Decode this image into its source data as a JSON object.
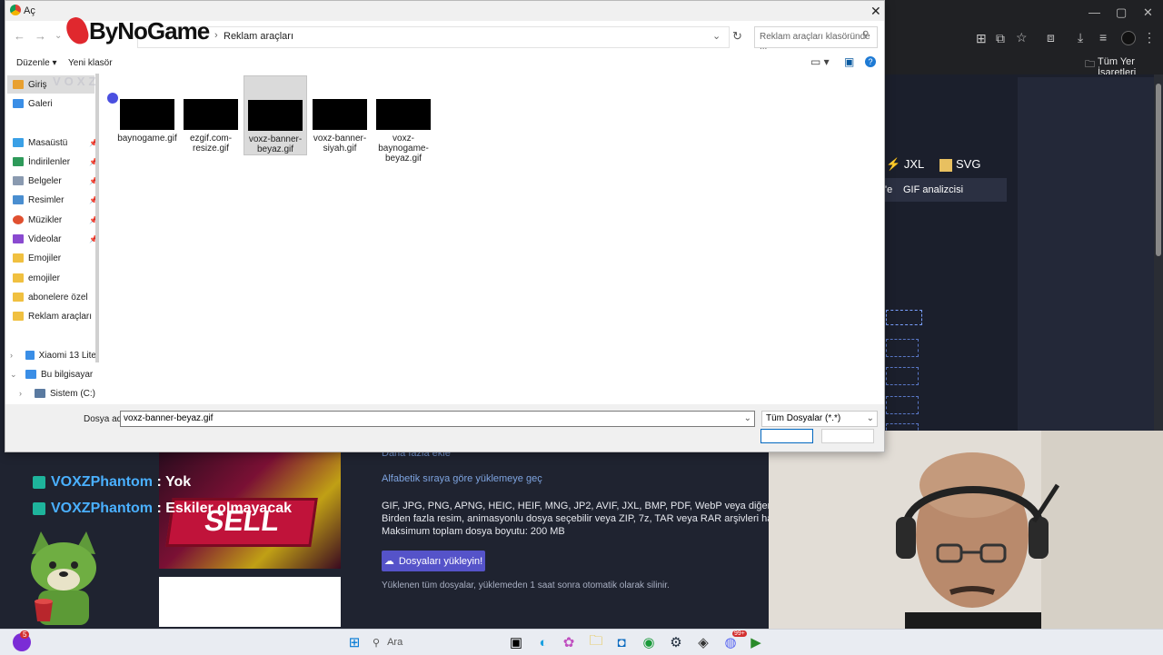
{
  "dialog": {
    "title": "Aç",
    "breadcrumb": [
      "Reklam araçları"
    ],
    "search_placeholder": "Reklam araçları klasöründe ...",
    "toolbar": {
      "organize": "Düzenle",
      "new_folder": "Yeni klasör"
    },
    "sidebar": {
      "items": [
        {
          "label": "Giriş",
          "icon": "home-icon",
          "pinned": false
        },
        {
          "label": "Galeri",
          "icon": "gallery-icon",
          "pinned": false
        },
        {
          "label": "Masaüstü",
          "icon": "desktop-icon",
          "pinned": true
        },
        {
          "label": "İndirilenler",
          "icon": "download-icon",
          "pinned": true
        },
        {
          "label": "Belgeler",
          "icon": "documents-icon",
          "pinned": true
        },
        {
          "label": "Resimler",
          "icon": "pictures-icon",
          "pinned": true
        },
        {
          "label": "Müzikler",
          "icon": "music-icon",
          "pinned": true
        },
        {
          "label": "Videolar",
          "icon": "videos-icon",
          "pinned": true
        },
        {
          "label": "Emojiler",
          "icon": "folder-icon",
          "pinned": false
        },
        {
          "label": "emojiler",
          "icon": "folder-icon",
          "pinned": false
        },
        {
          "label": "abonelere özel",
          "icon": "folder-icon",
          "pinned": false
        },
        {
          "label": "Reklam araçları",
          "icon": "folder-icon",
          "pinned": false
        },
        {
          "label": "Xiaomi 13 Lite",
          "icon": "phone-icon",
          "pinned": false
        },
        {
          "label": "Bu bilgisayar",
          "icon": "computer-icon",
          "pinned": false
        },
        {
          "label": "Sistem (C:)",
          "icon": "drive-icon",
          "pinned": false
        }
      ]
    },
    "files": [
      {
        "name": "baynogame.gif",
        "selected": false
      },
      {
        "name": "ezgif.com-resize.gif",
        "selected": false
      },
      {
        "name": "voxz-banner-beyaz.gif",
        "selected": true
      },
      {
        "name": "voxz-banner-siyah.gif",
        "selected": false
      },
      {
        "name": "voxz-baynogame-beyaz.gif",
        "selected": false
      }
    ],
    "filename_label": "Dosya adı:",
    "filename_value": "voxz-banner-beyaz.gif",
    "filetype": "Tüm Dosyalar (*.*)"
  },
  "overlay": {
    "logo_text": "ByNoGame",
    "ghost_text": "VOXZ"
  },
  "browser": {
    "bookmarks_label": "Tüm Yer İşaretleri",
    "formats": [
      "JXL",
      "SVG"
    ],
    "tab_prefix": "'e",
    "tab_label": "GIF analizcisi"
  },
  "page": {
    "sort_link": "Alfabetik sıraya göre yüklemeye geç",
    "more_link": "Daha fazla ekle",
    "info_lines": [
      "GIF, JPG, PNG, APNG, HEIC, HEIF, MNG, JP2, AVIF, JXL, BMP, PDF, WebP veya diğer resim formatları",
      "Birden fazla resim, animasyonlu dosya seçebilir veya ZIP, 7z, TAR veya RAR arşivleri halinde resimleri",
      "Maksimum toplam dosya boyutu: 200 MB"
    ],
    "upload_button": "Dosyaları yükleyin!",
    "note": "Yüklenen tüm dosyalar, yüklemeden 1 saat sonra otomatik olarak silinir."
  },
  "stream": {
    "chat": [
      {
        "user": "VOXZPhantom",
        "message": ": Yok"
      },
      {
        "user": "VOXZPhantom",
        "message": ": Eskiler olmayacak"
      }
    ],
    "banner_text": "SELL"
  },
  "taskbar": {
    "search_label": "Ara",
    "badge_count": "5",
    "discord_badge": "99+"
  }
}
